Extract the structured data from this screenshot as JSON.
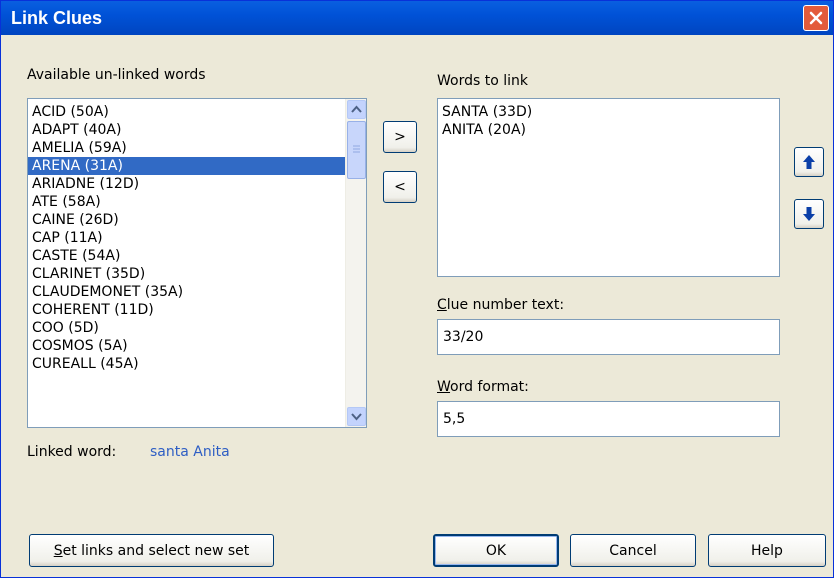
{
  "window": {
    "title": "Link Clues"
  },
  "available": {
    "label": "Available un-linked words",
    "items": [
      "ACID (50A)",
      "ADAPT (40A)",
      "AMELIA (59A)",
      "ARENA (31A)",
      "ARIADNE (12D)",
      "ATE (58A)",
      "CAINE (26D)",
      "CAP (11A)",
      "CASTE (54A)",
      "CLARINET (35D)",
      "CLAUDEMONET (35A)",
      "COHERENT (11D)",
      "COO (5D)",
      "COSMOS (5A)",
      "CUREALL (45A)"
    ],
    "selected": "ARENA (31A)"
  },
  "linked_word": {
    "label": "Linked word:",
    "value": "santa Anita"
  },
  "arrows": {
    "add": ">",
    "remove": "<"
  },
  "to_link": {
    "label": "Words to link",
    "items": [
      "SANTA (33D)",
      "ANITA (20A)"
    ]
  },
  "clue_number": {
    "label_accel": "C",
    "label_rest": "lue number text:",
    "value": "33/20"
  },
  "word_format": {
    "label_accel": "W",
    "label_rest": "ord format:",
    "value": "5,5"
  },
  "buttons": {
    "set_links_accel": "S",
    "set_links_rest": "et links and select new set",
    "ok": "OK",
    "cancel": "Cancel",
    "help": "Help"
  },
  "colors": {
    "titlebar": "#0054E3",
    "selection": "#316AC5",
    "linked_value": "#2E5EC4",
    "face": "#ECE9D8"
  }
}
